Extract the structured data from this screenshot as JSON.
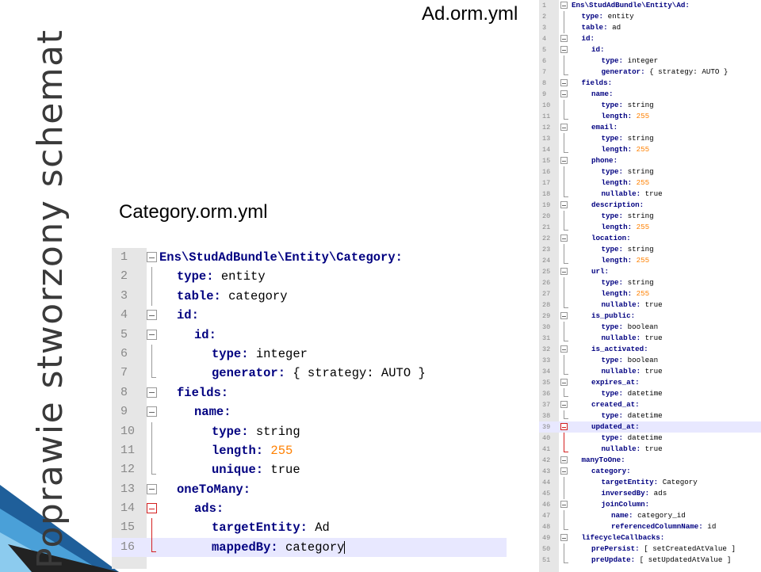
{
  "slide": {
    "title": "Poprawie stworzony schemat"
  },
  "ad_file": {
    "label": "Ad.orm.yml",
    "highlight_line": 39,
    "lines": [
      {
        "n": "1",
        "i": 0,
        "k": "Ens\\StudAdBundle\\Entity\\Ad:",
        "v": "",
        "t": "",
        "f": "open"
      },
      {
        "n": "2",
        "i": 1,
        "k": "type:",
        "v": " entity",
        "t": "",
        "f": ""
      },
      {
        "n": "3",
        "i": 1,
        "k": "table:",
        "v": " ad",
        "t": "",
        "f": ""
      },
      {
        "n": "4",
        "i": 1,
        "k": "id:",
        "v": "",
        "t": "",
        "f": "open"
      },
      {
        "n": "5",
        "i": 2,
        "k": "id:",
        "v": "",
        "t": "",
        "f": "open"
      },
      {
        "n": "6",
        "i": 3,
        "k": "type:",
        "v": " integer",
        "t": "",
        "f": ""
      },
      {
        "n": "7",
        "i": 3,
        "k": "generator:",
        "v": " { strategy: AUTO }",
        "t": "",
        "f": "end"
      },
      {
        "n": "8",
        "i": 1,
        "k": "fields:",
        "v": "",
        "t": "",
        "f": "open"
      },
      {
        "n": "9",
        "i": 2,
        "k": "name:",
        "v": "",
        "t": "",
        "f": "open"
      },
      {
        "n": "10",
        "i": 3,
        "k": "type:",
        "v": " string",
        "t": "",
        "f": ""
      },
      {
        "n": "11",
        "i": 3,
        "k": "length:",
        "v": "",
        "t": " 255",
        "f": "end"
      },
      {
        "n": "12",
        "i": 2,
        "k": "email:",
        "v": "",
        "t": "",
        "f": "open"
      },
      {
        "n": "13",
        "i": 3,
        "k": "type:",
        "v": " string",
        "t": "",
        "f": ""
      },
      {
        "n": "14",
        "i": 3,
        "k": "length:",
        "v": "",
        "t": " 255",
        "f": "end"
      },
      {
        "n": "15",
        "i": 2,
        "k": "phone:",
        "v": "",
        "t": "",
        "f": "open"
      },
      {
        "n": "16",
        "i": 3,
        "k": "type:",
        "v": " string",
        "t": "",
        "f": ""
      },
      {
        "n": "17",
        "i": 3,
        "k": "length:",
        "v": "",
        "t": " 255",
        "f": ""
      },
      {
        "n": "18",
        "i": 3,
        "k": "nullable:",
        "v": " true",
        "t": "",
        "f": "end"
      },
      {
        "n": "19",
        "i": 2,
        "k": "description:",
        "v": "",
        "t": "",
        "f": "open"
      },
      {
        "n": "20",
        "i": 3,
        "k": "type:",
        "v": " string",
        "t": "",
        "f": ""
      },
      {
        "n": "21",
        "i": 3,
        "k": "length:",
        "v": "",
        "t": " 255",
        "f": "end"
      },
      {
        "n": "22",
        "i": 2,
        "k": "location:",
        "v": "",
        "t": "",
        "f": "open"
      },
      {
        "n": "23",
        "i": 3,
        "k": "type:",
        "v": " string",
        "t": "",
        "f": ""
      },
      {
        "n": "24",
        "i": 3,
        "k": "length:",
        "v": "",
        "t": " 255",
        "f": "end"
      },
      {
        "n": "25",
        "i": 2,
        "k": "url:",
        "v": "",
        "t": "",
        "f": "open"
      },
      {
        "n": "26",
        "i": 3,
        "k": "type:",
        "v": " string",
        "t": "",
        "f": ""
      },
      {
        "n": "27",
        "i": 3,
        "k": "length:",
        "v": "",
        "t": " 255",
        "f": ""
      },
      {
        "n": "28",
        "i": 3,
        "k": "nullable:",
        "v": " true",
        "t": "",
        "f": "end"
      },
      {
        "n": "29",
        "i": 2,
        "k": "is_public:",
        "v": "",
        "t": "",
        "f": "open"
      },
      {
        "n": "30",
        "i": 3,
        "k": "type:",
        "v": " boolean",
        "t": "",
        "f": ""
      },
      {
        "n": "31",
        "i": 3,
        "k": "nullable:",
        "v": " true",
        "t": "",
        "f": "end"
      },
      {
        "n": "32",
        "i": 2,
        "k": "is_activated:",
        "v": "",
        "t": "",
        "f": "open"
      },
      {
        "n": "33",
        "i": 3,
        "k": "type:",
        "v": " boolean",
        "t": "",
        "f": ""
      },
      {
        "n": "34",
        "i": 3,
        "k": "nullable:",
        "v": " true",
        "t": "",
        "f": "end"
      },
      {
        "n": "35",
        "i": 2,
        "k": "expires_at:",
        "v": "",
        "t": "",
        "f": "open"
      },
      {
        "n": "36",
        "i": 3,
        "k": "type:",
        "v": " datetime",
        "t": "",
        "f": "end"
      },
      {
        "n": "37",
        "i": 2,
        "k": "created_at:",
        "v": "",
        "t": "",
        "f": "open"
      },
      {
        "n": "38",
        "i": 3,
        "k": "type:",
        "v": " datetime",
        "t": "",
        "f": "end"
      },
      {
        "n": "39",
        "i": 2,
        "k": "updated_at:",
        "v": "",
        "t": "",
        "f": "open-red"
      },
      {
        "n": "40",
        "i": 3,
        "k": "type:",
        "v": " datetime",
        "t": "",
        "f": "red"
      },
      {
        "n": "41",
        "i": 3,
        "k": "nullable:",
        "v": " true",
        "t": "",
        "f": "end-red"
      },
      {
        "n": "42",
        "i": 1,
        "k": "manyToOne:",
        "v": "",
        "t": "",
        "f": "open"
      },
      {
        "n": "43",
        "i": 2,
        "k": "category:",
        "v": "",
        "t": "",
        "f": "open"
      },
      {
        "n": "44",
        "i": 3,
        "k": "targetEntity:",
        "v": " Category",
        "t": "",
        "f": ""
      },
      {
        "n": "45",
        "i": 3,
        "k": "inversedBy:",
        "v": " ads",
        "t": "",
        "f": ""
      },
      {
        "n": "46",
        "i": 3,
        "k": "joinColumn:",
        "v": "",
        "t": "",
        "f": "open"
      },
      {
        "n": "47",
        "i": 4,
        "k": "name:",
        "v": " category_id",
        "t": "",
        "f": ""
      },
      {
        "n": "48",
        "i": 4,
        "k": "referencedColumnName:",
        "v": " id",
        "t": "",
        "f": "end"
      },
      {
        "n": "49",
        "i": 1,
        "k": "lifecycleCallbacks:",
        "v": "",
        "t": "",
        "f": "open"
      },
      {
        "n": "50",
        "i": 2,
        "k": "prePersist:",
        "v": " [ setCreatedAtValue ]",
        "t": "",
        "f": ""
      },
      {
        "n": "51",
        "i": 2,
        "k": "preUpdate:",
        "v": " [ setUpdatedAtValue ]",
        "t": "",
        "f": "end"
      }
    ]
  },
  "category_file": {
    "label": "Category.orm.yml",
    "highlight_line": 16,
    "lines": [
      {
        "n": "1",
        "i": 0,
        "k": "Ens\\StudAdBundle\\Entity\\Category:",
        "v": "",
        "t": "",
        "f": "open"
      },
      {
        "n": "2",
        "i": 1,
        "k": "type:",
        "v": " entity",
        "t": "",
        "f": ""
      },
      {
        "n": "3",
        "i": 1,
        "k": "table:",
        "v": " category",
        "t": "",
        "f": ""
      },
      {
        "n": "4",
        "i": 1,
        "k": "id:",
        "v": "",
        "t": "",
        "f": "open"
      },
      {
        "n": "5",
        "i": 2,
        "k": "id:",
        "v": "",
        "t": "",
        "f": "open"
      },
      {
        "n": "6",
        "i": 3,
        "k": "type:",
        "v": " integer",
        "t": "",
        "f": ""
      },
      {
        "n": "7",
        "i": 3,
        "k": "generator:",
        "v": " { strategy: AUTO }",
        "t": "",
        "f": "end"
      },
      {
        "n": "8",
        "i": 1,
        "k": "fields:",
        "v": "",
        "t": "",
        "f": "open"
      },
      {
        "n": "9",
        "i": 2,
        "k": "name:",
        "v": "",
        "t": "",
        "f": "open"
      },
      {
        "n": "10",
        "i": 3,
        "k": "type:",
        "v": " string",
        "t": "",
        "f": ""
      },
      {
        "n": "11",
        "i": 3,
        "k": "length:",
        "v": "",
        "t": " 255",
        "f": ""
      },
      {
        "n": "12",
        "i": 3,
        "k": "unique:",
        "v": " true",
        "t": "",
        "f": "end"
      },
      {
        "n": "13",
        "i": 1,
        "k": "oneToMany:",
        "v": "",
        "t": "",
        "f": "open"
      },
      {
        "n": "14",
        "i": 2,
        "k": "ads:",
        "v": "",
        "t": "",
        "f": "open-red"
      },
      {
        "n": "15",
        "i": 3,
        "k": "targetEntity:",
        "v": " Ad",
        "t": "",
        "f": "red"
      },
      {
        "n": "16",
        "i": 3,
        "k": "mappedBy:",
        "v": " category",
        "t": "",
        "f": "end-red"
      }
    ]
  }
}
